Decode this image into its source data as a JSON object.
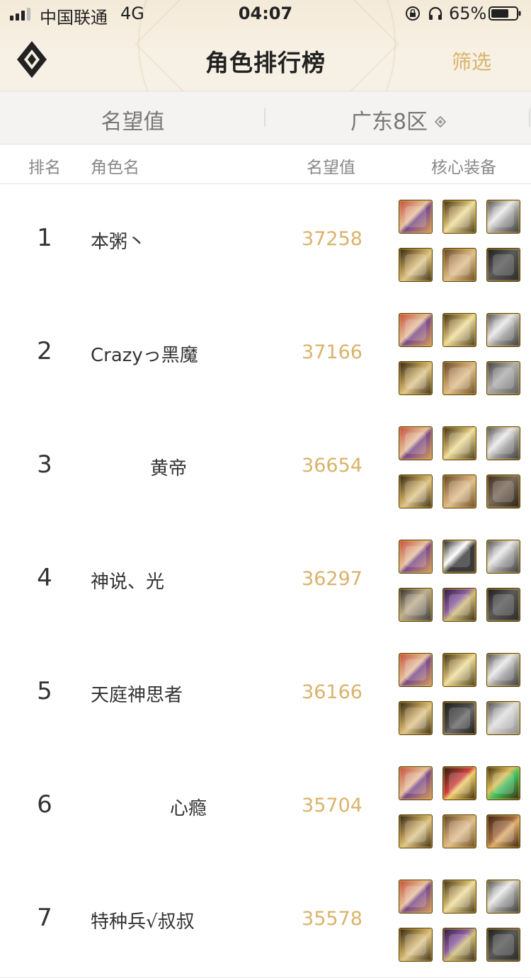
{
  "status": {
    "carrier": "中国联通",
    "network": "4G",
    "time": "04:07",
    "battery": "65%"
  },
  "header": {
    "title": "角色排行榜",
    "filter_label": "筛选"
  },
  "filterbar": {
    "left": "名望值",
    "right": "广东8区"
  },
  "columns": {
    "rank": "排名",
    "name": "角色名",
    "score": "名望值",
    "gear": "核心装备"
  },
  "colors": {
    "accent": "#d9b36a",
    "text": "#333333",
    "muted": "#888888"
  },
  "rows": [
    {
      "rank": "1",
      "name": "本粥丶",
      "score": "37258",
      "gear": [
        "weapon-icon",
        "helm-icon",
        "shoulder-icon",
        "glove-icon",
        "chest-icon",
        "pants-icon"
      ]
    },
    {
      "rank": "2",
      "name": "Crazyっ黑魔",
      "score": "37166",
      "gear": [
        "weapon-icon",
        "helm-icon",
        "shoulder-icon",
        "glove-icon",
        "chest-icon",
        "boots-icon"
      ]
    },
    {
      "rank": "3",
      "name": "黄帝",
      "score": "36654",
      "gear": [
        "weapon-icon",
        "helm-icon",
        "shoulder-icon",
        "glove-icon",
        "chest-icon",
        "cloak-icon"
      ]
    },
    {
      "rank": "4",
      "name": "神说、光",
      "score": "36297",
      "gear": [
        "weapon-icon",
        "ring-icon",
        "shoulder-icon",
        "headset-icon",
        "armor-icon",
        "pants-icon"
      ]
    },
    {
      "rank": "5",
      "name": "天庭神思者",
      "score": "36166",
      "gear": [
        "weapon-icon",
        "helm-icon",
        "shoulder-icon",
        "glove-icon",
        "dark-chest-icon",
        "skirt-icon"
      ]
    },
    {
      "rank": "6",
      "name": "心瘾",
      "score": "35704",
      "gear": [
        "weapon-icon",
        "red-ring-icon",
        "gem-icon",
        "glove-icon",
        "chest-icon",
        "belt-icon"
      ]
    },
    {
      "rank": "7",
      "name": "特种兵√叔叔",
      "score": "35578",
      "gear": [
        "weapon-icon",
        "helm-icon",
        "shoulder-icon",
        "glove-icon",
        "armor-icon",
        "pants-icon"
      ]
    }
  ]
}
